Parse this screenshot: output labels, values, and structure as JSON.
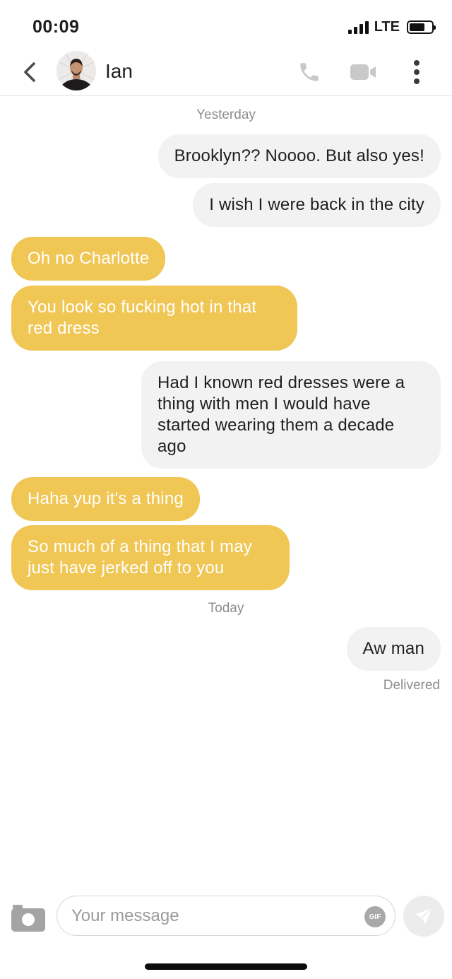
{
  "status_bar": {
    "time": "00:09",
    "network": "LTE",
    "signal_bars": 4,
    "battery_level": 0.7
  },
  "header": {
    "back_icon": "chevron-left-icon",
    "contact_name": "Ian",
    "call_icon": "phone-icon",
    "video_icon": "video-camera-icon",
    "more_icon": "more-vertical-icon"
  },
  "conversation": {
    "day_divider_1": "Yesterday",
    "day_divider_2": "Today",
    "messages": [
      {
        "direction": "outgoing",
        "text": "Brooklyn?? Noooo. But also yes!"
      },
      {
        "direction": "outgoing",
        "text": "I wish I were back in the city"
      },
      {
        "direction": "incoming",
        "text": "Oh no Charlotte"
      },
      {
        "direction": "incoming",
        "text": "You look so fucking hot in that red dress"
      },
      {
        "direction": "outgoing",
        "text": "Had I known red dresses were a thing with men I would have started wearing them a decade ago"
      },
      {
        "direction": "incoming",
        "text": "Haha yup it's a thing"
      },
      {
        "direction": "incoming",
        "text": "So much of a thing that I may just have jerked off to you"
      },
      {
        "direction": "outgoing",
        "text": "Aw man"
      }
    ],
    "delivery_status": "Delivered"
  },
  "composer": {
    "camera_icon": "camera-icon",
    "placeholder": "Your message",
    "value": "",
    "gif_label": "GIF",
    "send_icon": "send-icon"
  },
  "colors": {
    "incoming_bubble": "#f0c655",
    "outgoing_bubble": "#f2f2f3",
    "meta_text": "#8c8c8c"
  }
}
